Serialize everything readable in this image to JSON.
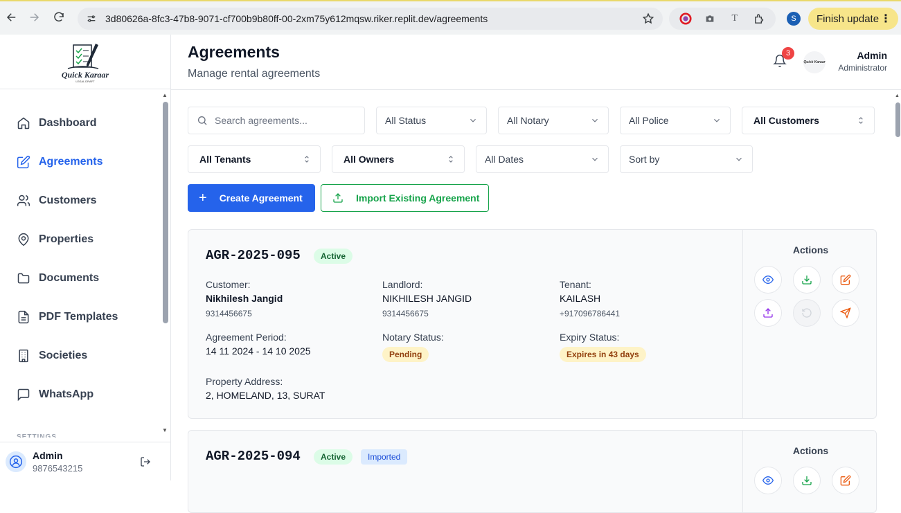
{
  "browser": {
    "url": "3d80626a-8fc3-47b8-9071-cf700b9b80ff-00-2xm75y612mqsw.riker.replit.dev/agreements",
    "profile_initial": "S",
    "finish_update": "Finish update"
  },
  "logo": {
    "title": "Quick Karaar",
    "subtitle": "LEGAL DRAFT"
  },
  "sidebar": {
    "items": [
      {
        "label": "Dashboard",
        "icon": "home-icon"
      },
      {
        "label": "Agreements",
        "icon": "edit-icon",
        "active": true
      },
      {
        "label": "Customers",
        "icon": "users-icon"
      },
      {
        "label": "Properties",
        "icon": "map-pin-icon"
      },
      {
        "label": "Documents",
        "icon": "folder-icon"
      },
      {
        "label": "PDF Templates",
        "icon": "file-text-icon"
      },
      {
        "label": "Societies",
        "icon": "building-icon"
      },
      {
        "label": "WhatsApp",
        "icon": "message-icon"
      }
    ],
    "settings_label": "SETTINGS",
    "user": {
      "name": "Admin",
      "phone": "9876543215"
    }
  },
  "header": {
    "title": "Agreements",
    "subtitle": "Manage rental agreements",
    "notification_count": "3",
    "user_name": "Admin",
    "user_role": "Administrator"
  },
  "filters": {
    "search_placeholder": "Search agreements...",
    "status": "All Status",
    "notary": "All Notary",
    "police": "All Police",
    "customers": "All Customers",
    "tenants": "All Tenants",
    "owners": "All Owners",
    "dates": "All Dates",
    "sort": "Sort by"
  },
  "buttons": {
    "create": "Create Agreement",
    "import": "Import Existing Agreement"
  },
  "labels": {
    "customer": "Customer:",
    "landlord": "Landlord:",
    "tenant": "Tenant:",
    "period": "Agreement Period:",
    "notary_status": "Notary Status:",
    "expiry_status": "Expiry Status:",
    "address": "Property Address:",
    "actions": "Actions"
  },
  "agreements": [
    {
      "id": "AGR-2025-095",
      "status": "Active",
      "customer_name": "Nikhilesh Jangid",
      "customer_phone": "9314456675",
      "landlord_name": "NIKHILESH JANGID",
      "landlord_phone": "9314456675",
      "tenant_name": "KAILASH",
      "tenant_phone": "+917096786441",
      "period": "14 11 2024 - 14 10 2025",
      "notary_status": "Pending",
      "expiry_status": "Expires in 43 days",
      "address": "2, HOMELAND, 13, SURAT"
    },
    {
      "id": "AGR-2025-094",
      "status": "Active",
      "tag": "Imported"
    }
  ],
  "colors": {
    "primary": "#2563eb",
    "success": "#16a34a",
    "danger": "#ef4444",
    "warning_bg": "#fef3c7"
  }
}
